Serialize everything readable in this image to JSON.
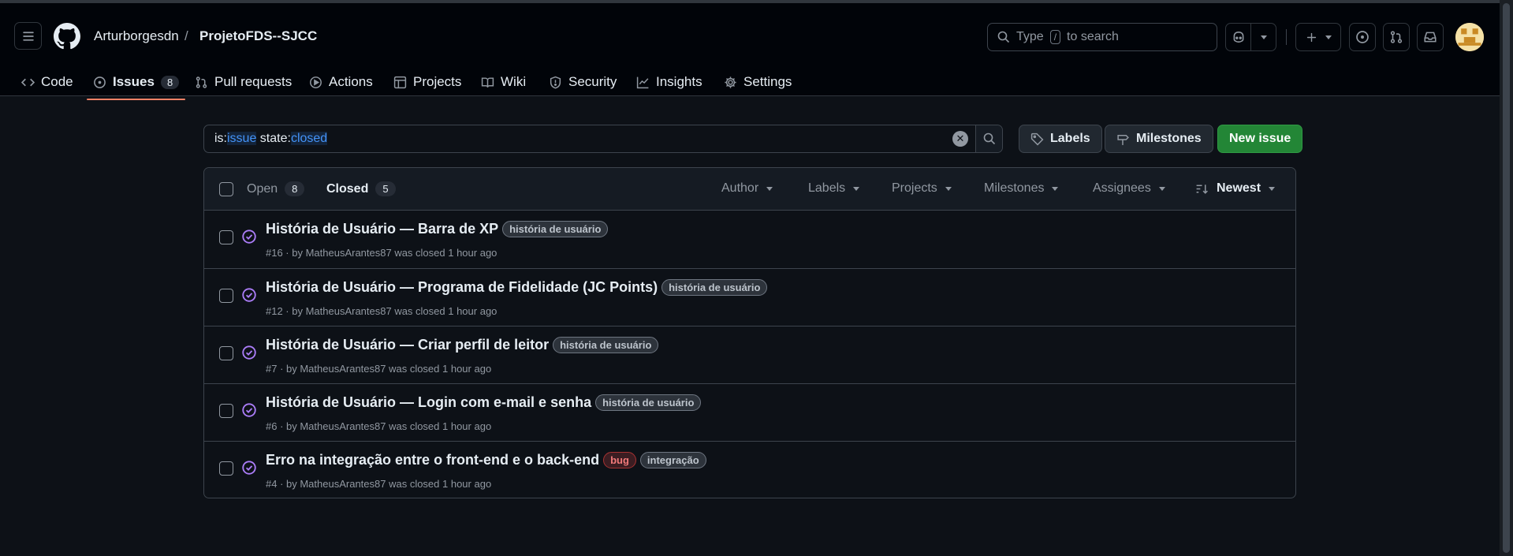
{
  "header": {
    "owner": "Arturborgesdn",
    "separator": "/",
    "repo": "ProjetoFDS--SJCC",
    "search_prefix": "Type",
    "search_key": "/",
    "search_suffix": "to search"
  },
  "tabs": [
    {
      "label": "Code",
      "icon": "code-icon"
    },
    {
      "label": "Issues",
      "icon": "issue-opened-icon",
      "count": "8"
    },
    {
      "label": "Pull requests",
      "icon": "git-pull-request-icon"
    },
    {
      "label": "Actions",
      "icon": "play-icon"
    },
    {
      "label": "Projects",
      "icon": "table-icon"
    },
    {
      "label": "Wiki",
      "icon": "book-icon"
    },
    {
      "label": "Security",
      "icon": "shield-icon"
    },
    {
      "label": "Insights",
      "icon": "graph-icon"
    },
    {
      "label": "Settings",
      "icon": "gear-icon"
    }
  ],
  "filter": {
    "k1": "is:",
    "v1": "issue",
    "k2": " state:",
    "v2": "closed"
  },
  "buttons": {
    "labels": "Labels",
    "milestones": "Milestones",
    "new_issue": "New issue"
  },
  "list": {
    "open_label": "Open",
    "open_count": "8",
    "closed_label": "Closed",
    "closed_count": "5",
    "filters": [
      "Author",
      "Labels",
      "Projects",
      "Milestones",
      "Assignees"
    ],
    "sort": "Newest",
    "issues": [
      {
        "title": "História de Usuário — Barra de XP",
        "labels": [
          "história de usuário"
        ],
        "meta": "#16 · by MatheusArantes87 was closed 1 hour ago"
      },
      {
        "title": "História de Usuário — Programa de Fidelidade (JC Points)",
        "labels": [
          "história de usuário"
        ],
        "meta": "#12 · by MatheusArantes87 was closed 1 hour ago"
      },
      {
        "title": "História de Usuário — Criar perfil de leitor",
        "labels": [
          "história de usuário"
        ],
        "meta": "#7 · by MatheusArantes87 was closed 1 hour ago"
      },
      {
        "title": "História de Usuário — Login com e-mail e senha",
        "labels": [
          "história de usuário"
        ],
        "meta": "#6 · by MatheusArantes87 was closed 1 hour ago"
      },
      {
        "title": "Erro na integração entre o front-end e o back-end",
        "labels": [
          "bug",
          "integração"
        ],
        "meta": "#4 · by MatheusArantes87 was closed 1 hour ago"
      }
    ]
  },
  "colors": {
    "accent_tab": "#f78166",
    "closed_icon": "#ab7df8",
    "primary_button": "#238636"
  }
}
